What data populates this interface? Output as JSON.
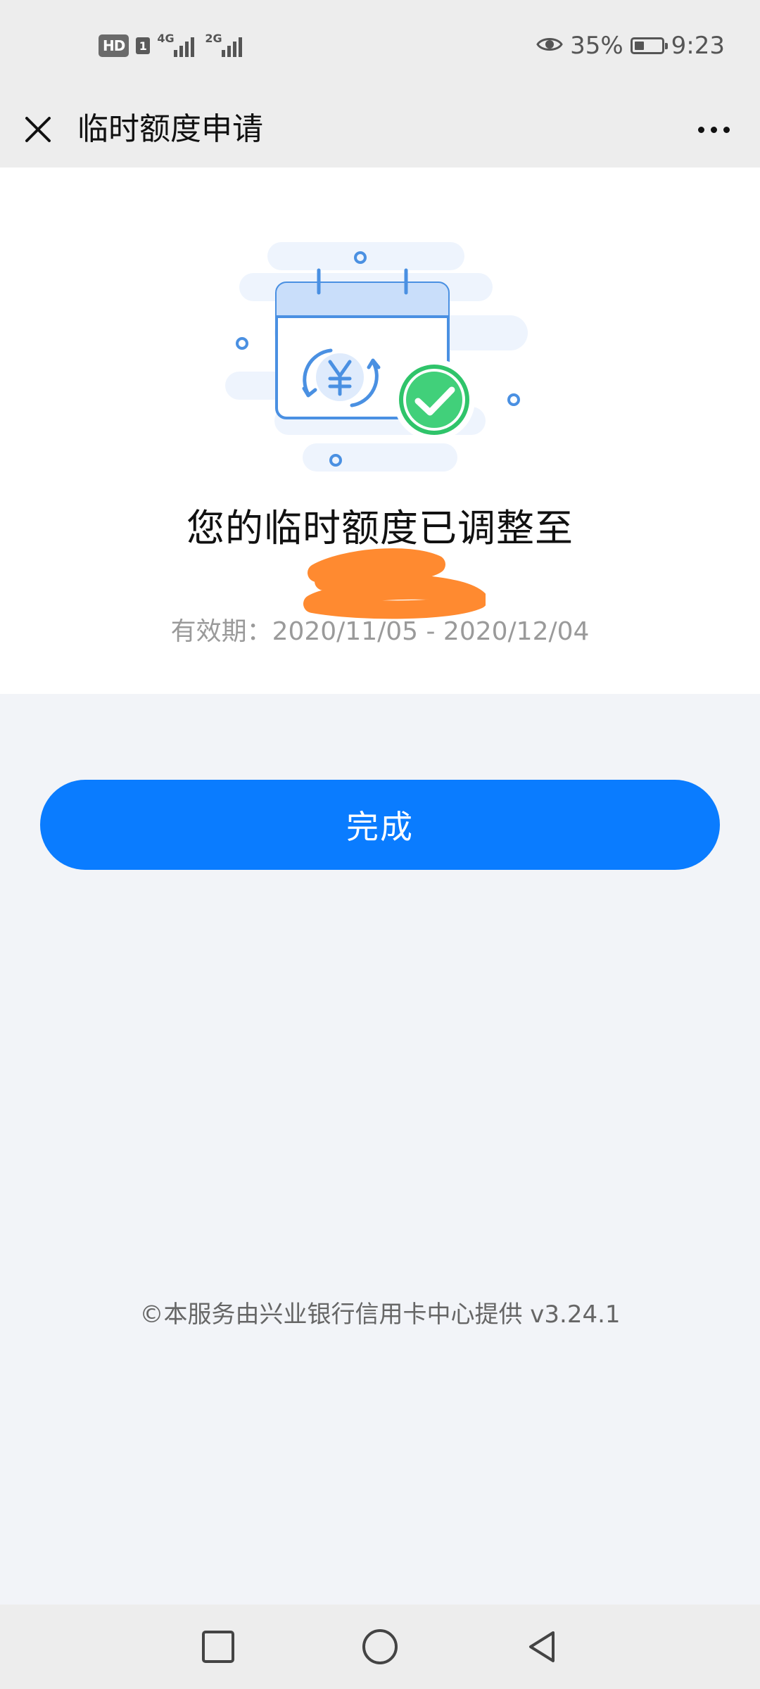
{
  "status_bar": {
    "hd_label": "HD",
    "sim_label": "1",
    "network_1": "4G",
    "network_2": "2G",
    "battery_percent": "35%",
    "battery_level": 0.35,
    "time": "9:23",
    "icons": [
      "eye-icon",
      "battery-icon"
    ]
  },
  "header": {
    "title": "临时额度申请",
    "close_icon": "close-icon",
    "more_icon": "more-icon"
  },
  "result": {
    "illustration_icon": "calendar-yen-check-illustration",
    "title": "您的临时额度已调整至",
    "validity": "有效期：2020/11/05 - 2020/12/04"
  },
  "actions": {
    "done_label": "完成"
  },
  "footer": {
    "text": "©本服务由兴业银行信用卡中心提供 v3.24.1"
  },
  "nav_bar": {
    "icons": [
      "recents-square-icon",
      "home-circle-icon",
      "back-triangle-icon"
    ]
  },
  "colors": {
    "primary": "#0a7cff",
    "success": "#2fc46a",
    "illustration_blue": "#4a90e2",
    "redaction": "#ff8a30"
  }
}
